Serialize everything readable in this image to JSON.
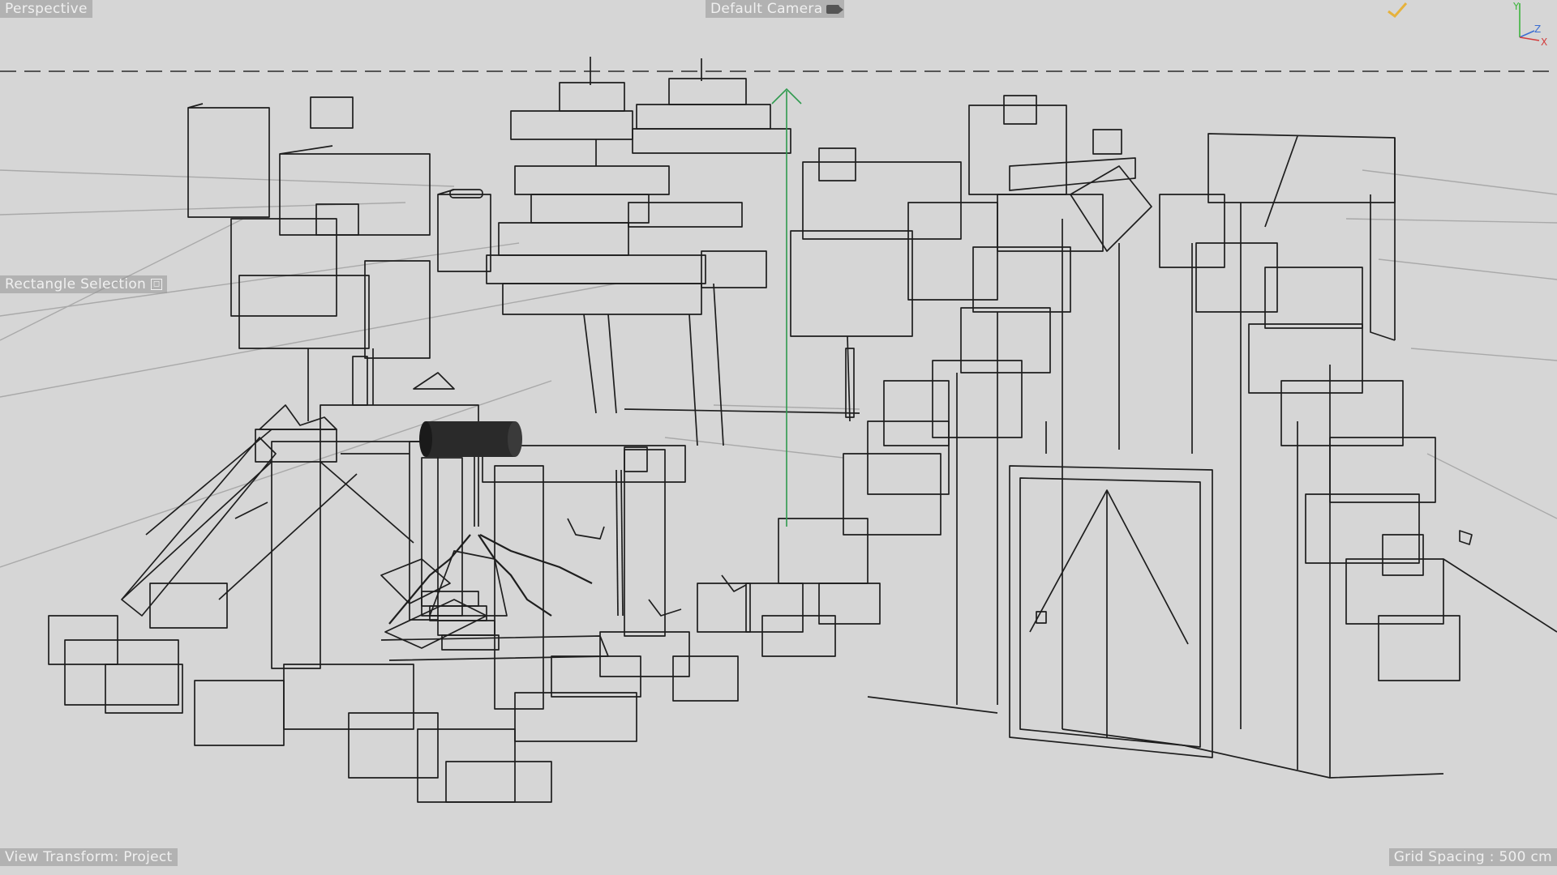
{
  "viewport": {
    "view_label": "Perspective",
    "camera_label": "Default Camera",
    "tool_label": "Rectangle Selection",
    "view_transform_label": "View Transform: Project",
    "grid_spacing_label": "Grid Spacing : 500 cm"
  },
  "axis_gizmo": {
    "y_label": "Y",
    "z_label": "Z",
    "x_label": "X",
    "colors": {
      "x": "#d23c3c",
      "y": "#3cb43c",
      "z": "#3c6ed2"
    }
  },
  "colors": {
    "background": "#d6d6d6",
    "wire": "#1e1e1e",
    "grid": "#a9a9a9",
    "move_handle": "#2e9a4e",
    "hud_text": "#f0f0f0"
  }
}
